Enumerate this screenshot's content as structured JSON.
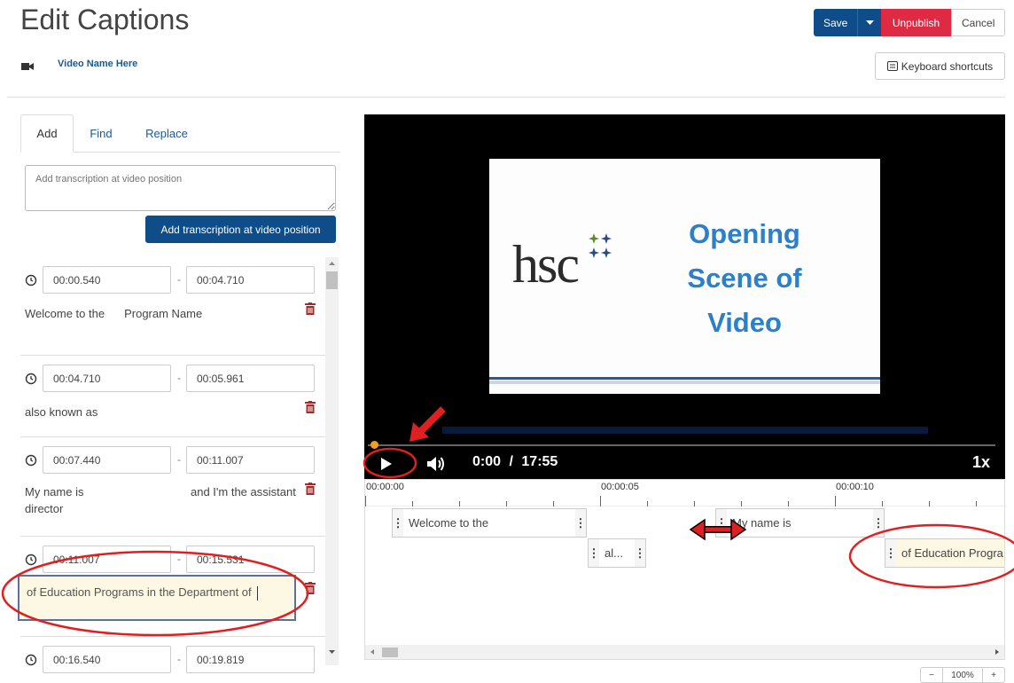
{
  "header": {
    "title": "Edit Captions",
    "video_name": "Video Name Here",
    "save_label": "Save",
    "unpublish_label": "Unpublish",
    "cancel_label": "Cancel",
    "keyboard_shortcuts_label": "Keyboard shortcuts"
  },
  "tabs": [
    {
      "label": "Add",
      "active": true
    },
    {
      "label": "Find",
      "active": false
    },
    {
      "label": "Replace",
      "active": false
    }
  ],
  "add_panel": {
    "textarea_placeholder": "Add transcription at video position",
    "button_label": "Add transcription at video position"
  },
  "cues": [
    {
      "start": "00:00.540",
      "end": "00:04.710",
      "text": "Welcome to the",
      "text_extra": "Program Name"
    },
    {
      "start": "00:04.710",
      "end": "00:05.961",
      "text": "also known as"
    },
    {
      "start": "00:07.440",
      "end": "00:11.007",
      "text": "My name is",
      "text_extra": "and I'm the assistant",
      "text_line2": "director"
    },
    {
      "start": "00:11.007",
      "end": "00:15.531",
      "text": "of Education Programs in the Department of"
    },
    {
      "start": "00:16.540",
      "end": "00:19.819"
    }
  ],
  "video": {
    "slide_logo": "hsc",
    "slide_title_lines": [
      "Opening",
      "Scene of",
      "Video"
    ],
    "current_time": "0:00",
    "separator": "/",
    "duration": "17:55",
    "speed": "1x",
    "progress": 0.0
  },
  "timeline": {
    "ruler_labels": [
      "00:00:00",
      "00:00:05",
      "00:00:10"
    ],
    "segments": [
      {
        "text": "Welcome to the"
      },
      {
        "text": "al..."
      },
      {
        "text": "My name is"
      },
      {
        "text": "of Education Progra"
      }
    ]
  },
  "zoom": {
    "level": "100%",
    "out": "−",
    "in": "+"
  },
  "colors": {
    "primary": "#0e4d8a",
    "danger": "#de2a42",
    "link": "#1b5a8f",
    "annotation": "#e02020",
    "highlight": "#fcf8e3"
  },
  "icons": [
    "video-camera-icon",
    "keyboard-icon",
    "clock-icon",
    "trash-icon",
    "play-icon",
    "volume-icon",
    "caret-down-icon",
    "zoom-out-icon",
    "zoom-in-icon"
  ]
}
